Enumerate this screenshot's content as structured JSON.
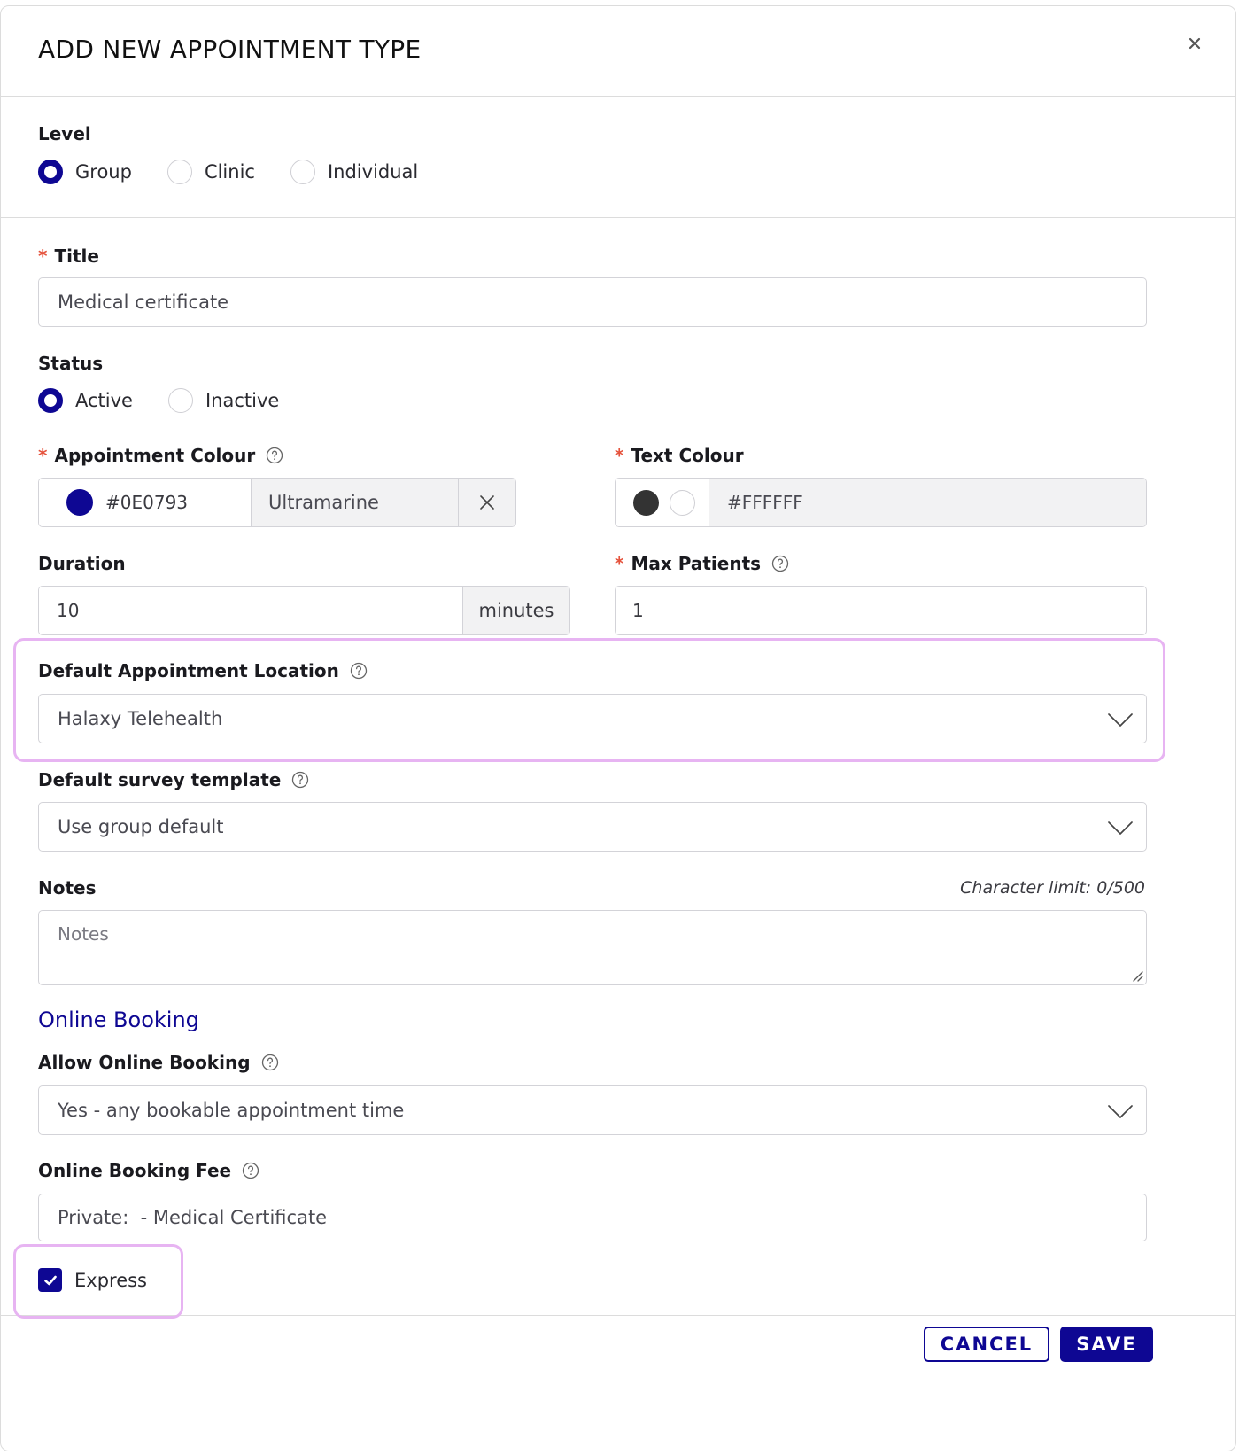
{
  "modal": {
    "title": "ADD NEW APPOINTMENT TYPE"
  },
  "level": {
    "label": "Level",
    "options": [
      "Group",
      "Clinic",
      "Individual"
    ],
    "selected": "Group"
  },
  "title_field": {
    "label": "Title",
    "value": "Medical certificate"
  },
  "status": {
    "label": "Status",
    "options": [
      "Active",
      "Inactive"
    ],
    "selected": "Active"
  },
  "appointment_colour": {
    "label": "Appointment Colour",
    "hex": "#0E0793",
    "name": "Ultramarine",
    "swatch": "#0e0793"
  },
  "text_colour": {
    "label": "Text Colour",
    "hex": "#FFFFFF",
    "swatches": [
      "#333333",
      "#ffffff"
    ]
  },
  "duration": {
    "label": "Duration",
    "value": "10",
    "unit": "minutes"
  },
  "max_patients": {
    "label": "Max Patients",
    "value": "1"
  },
  "default_location": {
    "label": "Default Appointment Location",
    "value": "Halaxy Telehealth"
  },
  "default_survey": {
    "label": "Default survey template",
    "value": "Use group default"
  },
  "notes": {
    "label": "Notes",
    "char_limit": "Character limit: 0/500",
    "placeholder": "Notes"
  },
  "online_booking": {
    "heading": "Online Booking",
    "allow_label": "Allow Online Booking",
    "allow_value": "Yes - any bookable appointment time",
    "fee_label": "Online Booking Fee",
    "fee_value": "Private:  - Medical Certificate"
  },
  "express": {
    "label": "Express",
    "checked": true
  },
  "footer": {
    "cancel_label": "CANCEL",
    "save_label": "SAVE"
  },
  "colors": {
    "accent": "#0e0793",
    "required": "#e5533d",
    "highlight": "#e7b4f2"
  }
}
